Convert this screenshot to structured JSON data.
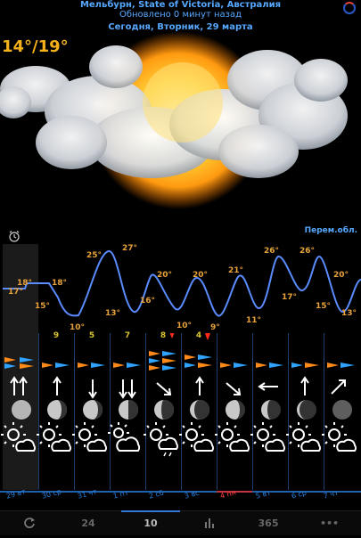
{
  "header": {
    "location": "Мельбурн, State of Victoria, Австралия",
    "updated": "Обновлено 0 минут назад",
    "date": "Сегодня, Вторник, 29 марта"
  },
  "current": {
    "temp": "14°/19°",
    "condition": "Перем.обл."
  },
  "graph": {
    "labels": [
      {
        "t": "18°",
        "c": "#e8a23a"
      },
      {
        "t": "17°",
        "c": "#e8a23a"
      },
      {
        "t": "15°",
        "c": "#e8a23a"
      },
      {
        "t": "18°",
        "c": "#e8a23a"
      },
      {
        "t": "10°",
        "c": "#e8a23a"
      },
      {
        "t": "25°",
        "c": "#e8a23a"
      },
      {
        "t": "13°",
        "c": "#e8a23a"
      },
      {
        "t": "27°",
        "c": "#e8a23a"
      },
      {
        "t": "16°",
        "c": "#e8a23a"
      },
      {
        "t": "20°",
        "c": "#e8a23a"
      },
      {
        "t": "10°",
        "c": "#e8a23a"
      },
      {
        "t": "20°",
        "c": "#e8a23a"
      },
      {
        "t": "9°",
        "c": "#e8a23a"
      },
      {
        "t": "21°",
        "c": "#e8a23a"
      },
      {
        "t": "11°",
        "c": "#e8a23a"
      },
      {
        "t": "26°",
        "c": "#e8a23a"
      },
      {
        "t": "17°",
        "c": "#e8a23a"
      },
      {
        "t": "26°",
        "c": "#e8a23a"
      },
      {
        "t": "15°",
        "c": "#e8a23a"
      },
      {
        "t": "20°",
        "c": "#e8a23a"
      },
      {
        "t": "13°",
        "c": "#e8a23a"
      }
    ]
  },
  "days": [
    {
      "prec": "",
      "label": "29 вт"
    },
    {
      "prec": "9",
      "label": "30 ср"
    },
    {
      "prec": "5",
      "label": "31 чт"
    },
    {
      "prec": "7",
      "label": "1 пт"
    },
    {
      "prec": "8",
      "label": "2 сб"
    },
    {
      "prec": "4",
      "label": "3 вс"
    },
    {
      "prec": "",
      "label": "4 пн"
    },
    {
      "prec": "",
      "label": "5 вт"
    },
    {
      "prec": "",
      "label": "6 ср"
    },
    {
      "prec": "",
      "label": "7 чт"
    }
  ],
  "tabs": {
    "t24": "24",
    "t10": "10",
    "t365": "365",
    "more": "•••"
  },
  "colors": {
    "accent": "#56a8ff",
    "temp": "#f5b11a",
    "line": "#5a8cff"
  }
}
